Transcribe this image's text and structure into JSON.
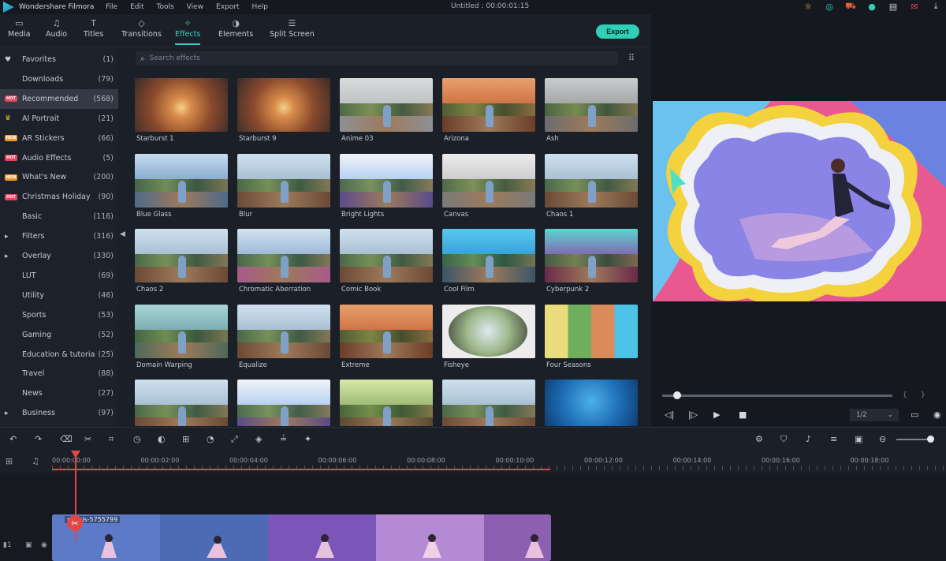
{
  "app": {
    "name": "Wondershare Filmora",
    "title": "Untitled : 00:00:01:15"
  },
  "menu": [
    "File",
    "Edit",
    "Tools",
    "View",
    "Export",
    "Help"
  ],
  "tabs": [
    {
      "label": "Media",
      "icon": "media-icon"
    },
    {
      "label": "Audio",
      "icon": "music-icon"
    },
    {
      "label": "Titles",
      "icon": "text-icon"
    },
    {
      "label": "Transitions",
      "icon": "transitions-icon"
    },
    {
      "label": "Effects",
      "icon": "effects-icon",
      "active": true
    },
    {
      "label": "Elements",
      "icon": "elements-icon"
    },
    {
      "label": "Split Screen",
      "icon": "split-screen-icon"
    }
  ],
  "export_label": "Export",
  "search_placeholder": "Search effects",
  "categories": [
    {
      "icon": "heart",
      "label": "Favorites",
      "count": "(1)"
    },
    {
      "icon": "",
      "label": "Downloads",
      "count": "(79)"
    },
    {
      "icon": "hot",
      "label": "Recommended",
      "count": "(568)",
      "active": true
    },
    {
      "icon": "crown",
      "label": "AI Portrait",
      "count": "(21)"
    },
    {
      "icon": "new",
      "label": "AR Stickers",
      "count": "(66)"
    },
    {
      "icon": "hot",
      "label": "Audio Effects",
      "count": "(5)"
    },
    {
      "icon": "new",
      "label": "What's New",
      "count": "(200)"
    },
    {
      "icon": "hot",
      "label": "Christmas Holiday",
      "count": "(90)"
    },
    {
      "icon": "",
      "label": "Basic",
      "count": "(116)"
    },
    {
      "icon": "arrow",
      "label": "Filters",
      "count": "(316)"
    },
    {
      "icon": "arrow",
      "label": "Overlay",
      "count": "(330)"
    },
    {
      "icon": "",
      "label": "LUT",
      "count": "(69)"
    },
    {
      "icon": "",
      "label": "Utility",
      "count": "(46)"
    },
    {
      "icon": "",
      "label": "Sports",
      "count": "(53)"
    },
    {
      "icon": "",
      "label": "Gaming",
      "count": "(52)"
    },
    {
      "icon": "",
      "label": "Education & tutoria",
      "count": "(25)"
    },
    {
      "icon": "",
      "label": "Travel",
      "count": "(88)"
    },
    {
      "icon": "",
      "label": "News",
      "count": "(27)"
    },
    {
      "icon": "arrow",
      "label": "Business",
      "count": "(97)"
    }
  ],
  "badges": {
    "hot": "HOT",
    "new": "NEW"
  },
  "effects": [
    {
      "label": "Starburst 1",
      "style": "warm"
    },
    {
      "label": "Starburst 9",
      "style": "warm"
    },
    {
      "label": "Anime 03",
      "style": "sketch"
    },
    {
      "label": "Arizona",
      "style": "orange"
    },
    {
      "label": "Ash",
      "style": "gray"
    },
    {
      "label": "Blue Glass",
      "style": "blue"
    },
    {
      "label": "Blur",
      "style": "normal"
    },
    {
      "label": "Bright Lights",
      "style": "bright"
    },
    {
      "label": "Canvas",
      "style": "canvas"
    },
    {
      "label": "Chaos 1",
      "style": "normal"
    },
    {
      "label": "Chaos 2",
      "style": "normal"
    },
    {
      "label": "Chromatic Aberration",
      "style": "chromatic"
    },
    {
      "label": "Comic Book",
      "style": "normal"
    },
    {
      "label": "Cool Film",
      "style": "cool"
    },
    {
      "label": "Cyberpunk 2",
      "style": "cyber"
    },
    {
      "label": "Domain Warping",
      "style": "teal"
    },
    {
      "label": "Equalize",
      "style": "normal"
    },
    {
      "label": "Extreme",
      "style": "orange"
    },
    {
      "label": "Fisheye",
      "style": "fisheye"
    },
    {
      "label": "Four Seasons",
      "style": "seasons"
    },
    {
      "label": "",
      "style": "normal"
    },
    {
      "label": "",
      "style": "bright"
    },
    {
      "label": "",
      "style": "green"
    },
    {
      "label": "",
      "style": "normal"
    },
    {
      "label": "",
      "style": "underwater"
    }
  ],
  "player": {
    "quality": "1/2"
  },
  "timecodes": [
    "00:00:00:00",
    "00:00:02:00",
    "00:00:04:00",
    "00:00:06:00",
    "00:00:08:00",
    "00:00:10:00",
    "00:00:12:00",
    "00:00:14:00",
    "00:00:16:00",
    "00:00:18:00"
  ],
  "clip": {
    "name": "pexels-5755799"
  },
  "colors": {
    "accent": "#35d0c4",
    "export": "#2fd0b5",
    "playhead": "#e04848",
    "hot": "#e2465d",
    "new": "#e99a2c"
  }
}
